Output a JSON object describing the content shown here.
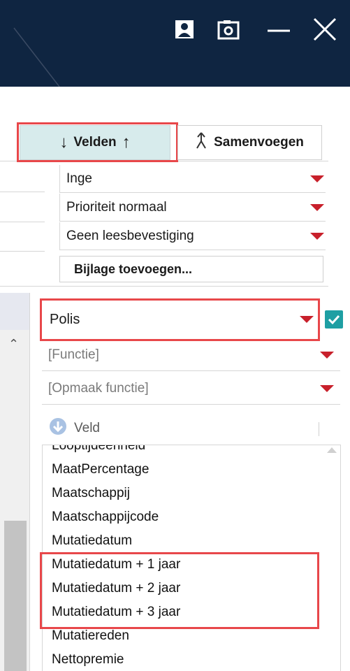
{
  "toolbar": {
    "tab_velden": "Velden",
    "tab_samenvoegen": "Samenvoegen"
  },
  "mail_options": {
    "sender": "Inge",
    "priority": "Prioriteit normaal",
    "read_receipt": "Geen leesbevestiging",
    "attach_label": "Bijlage toevoegen..."
  },
  "fields_panel": {
    "source": "Polis",
    "source_checked": true,
    "function_placeholder": "[Functie]",
    "format_placeholder": "[Opmaak functie]",
    "field_header": "Veld",
    "list": [
      "Looptijdeenheid",
      "MaatPercentage",
      "Maatschappij",
      "Maatschappijcode",
      "Mutatiedatum",
      "Mutatiedatum + 1 jaar",
      "Mutatiedatum + 2 jaar",
      "Mutatiedatum + 3 jaar",
      "Mutatiereden",
      "Nettopremie"
    ]
  },
  "colors": {
    "titlebar": "#0f2541",
    "accent_red": "#c8202b",
    "highlight_border": "#e8474a",
    "check_teal": "#1e9fa3",
    "tab_active": "#d7ebec"
  }
}
